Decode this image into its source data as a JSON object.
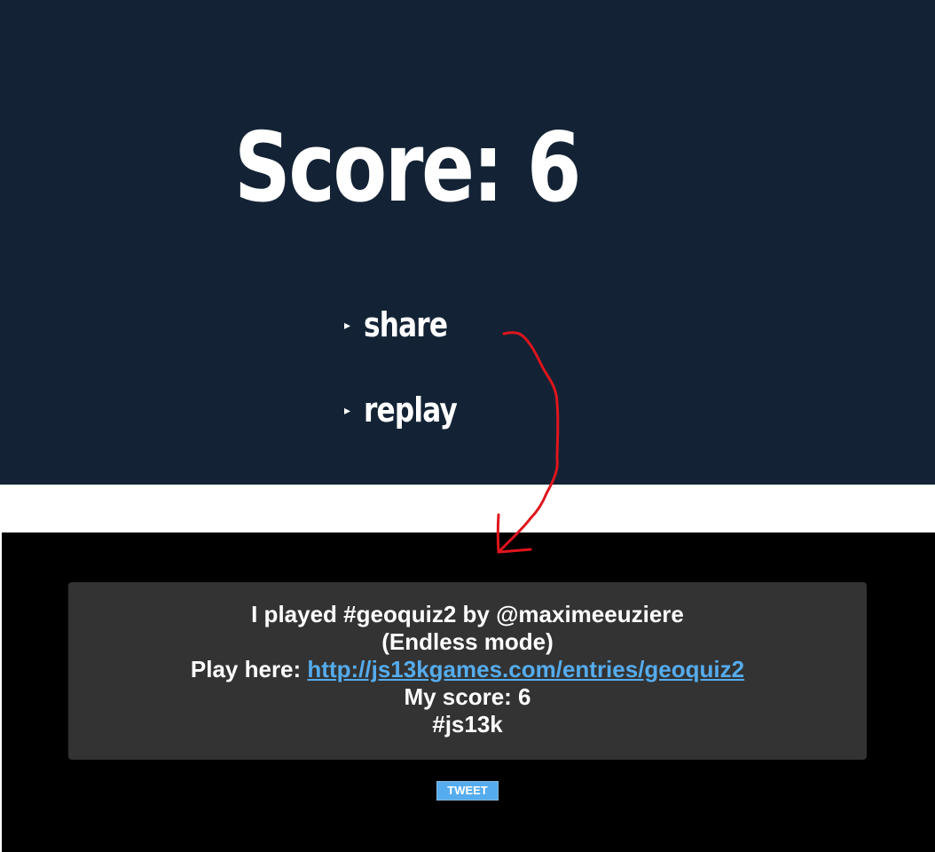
{
  "game": {
    "score_title": "Score: 6",
    "menu": [
      {
        "label": "share",
        "icon": "triangle-right-icon"
      },
      {
        "label": "replay",
        "icon": "triangle-right-icon"
      }
    ],
    "background_color": "#132335"
  },
  "share": {
    "line1": "I played #geoquiz2 by @maximeeuziere",
    "line2": "(Endless mode)",
    "line3_prefix": "Play here: ",
    "link": "http://js13kgames.com/entries/geoquiz2",
    "line4": "My score: 6",
    "line5": "#js13k",
    "tweet_button": "TWEET",
    "background_color": "#000000",
    "box_color": "#333333",
    "link_color": "#55acee"
  },
  "annotation": {
    "type": "hand-drawn arrow",
    "color": "#e0141c"
  }
}
